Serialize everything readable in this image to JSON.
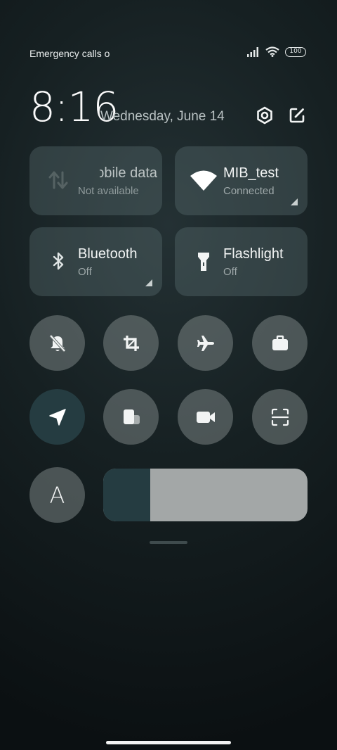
{
  "status_bar": {
    "text": "Emergency calls o",
    "battery": "100"
  },
  "header": {
    "time": "8:16",
    "date": "Wednesday, June 14"
  },
  "tiles": {
    "mobile_data": {
      "title": "Mobile data",
      "subtitle": "Not available"
    },
    "wifi": {
      "title": "MIB_test",
      "subtitle": "Connected"
    },
    "bluetooth": {
      "title": "Bluetooth",
      "subtitle": "Off"
    },
    "flashlight": {
      "title": "Flashlight",
      "subtitle": "Off"
    }
  },
  "toggles": [
    {
      "icon": "bell-off-icon",
      "active": false
    },
    {
      "icon": "crop-icon",
      "active": false
    },
    {
      "icon": "airplane-icon",
      "active": false
    },
    {
      "icon": "briefcase-icon",
      "active": false
    },
    {
      "icon": "location-arrow-icon",
      "active": true
    },
    {
      "icon": "floating-window-icon",
      "active": false
    },
    {
      "icon": "video-camera-icon",
      "active": false
    },
    {
      "icon": "scanner-icon",
      "active": false
    }
  ],
  "auto_brightness_label": "A",
  "brightness_level": 0.23,
  "colors": {
    "active": "#253c41",
    "tile": "#3b4a4c",
    "round": "#6e7777",
    "slider_track": "#a3a7a7"
  }
}
